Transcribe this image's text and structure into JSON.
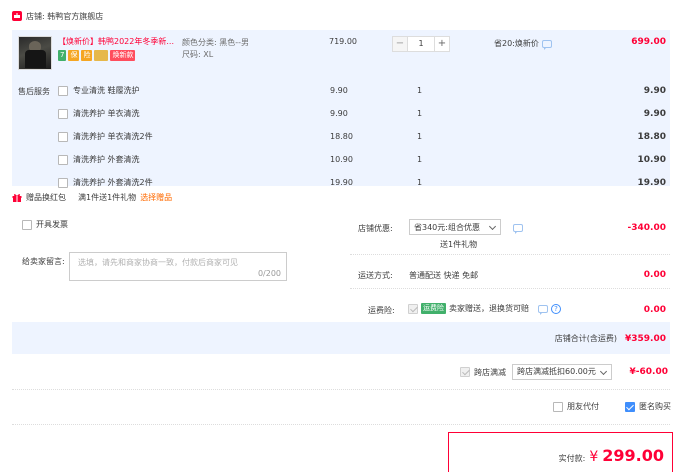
{
  "shop": {
    "label": "店铺: 韩鸭官方旗舰店"
  },
  "item": {
    "promo_tag": "【焕新价】",
    "title": "韩鸭2022年冬季新...",
    "spec1": "颜色分类: 黑色--男",
    "spec2": "尺码: XL",
    "unit_price": "719.00",
    "quantity": "1",
    "save_text": "省20:焕新价",
    "total": "699.00",
    "badges": [
      "7",
      "保",
      "险",
      "焕新款"
    ]
  },
  "after_sales": {
    "label": "售后服务",
    "options": [
      {
        "name": "专业清洗 鞋履洗护",
        "price": "9.90",
        "qty": "1",
        "total": "9.90"
      },
      {
        "name": "清洗养护 单衣清洗",
        "price": "9.90",
        "qty": "1",
        "total": "9.90"
      },
      {
        "name": "清洗养护 单衣清洗2件",
        "price": "18.80",
        "qty": "1",
        "total": "18.80"
      },
      {
        "name": "清洗养护 外套清洗",
        "price": "10.90",
        "qty": "1",
        "total": "10.90"
      },
      {
        "name": "清洗养护 外套清洗2件",
        "price": "19.90",
        "qty": "1",
        "total": "19.90"
      }
    ]
  },
  "gift": {
    "label": "赠品换红包",
    "text": "满1件送1件礼物",
    "link": "选择赠品"
  },
  "invoice": {
    "label": "开具发票"
  },
  "message": {
    "label": "给卖家留言:",
    "placeholder": "选填，请先和商家协商一致，付款后商家可见",
    "counter": "0/200"
  },
  "shop_discount": {
    "label": "店铺优惠:",
    "select": "省340元:组合优惠",
    "note": "送1件礼物",
    "amount": "-340.00"
  },
  "shipping": {
    "label": "运送方式:",
    "method": "普通配送 快递 免邮",
    "amount": "0.00"
  },
  "insurance": {
    "label": "运费险:",
    "badge": "运费险",
    "text": "卖家赠送，退换货可赔",
    "amount": "0.00"
  },
  "shop_total": {
    "label": "店铺合计(含运费)",
    "amount": "¥359.00"
  },
  "cross_discount": {
    "label": "跨店满减",
    "select": "跨店满减抵扣60.00元",
    "amount": "¥-60.00"
  },
  "options_row": {
    "friend_pay": "朋友代付",
    "anonymous": "匿名购买"
  },
  "payment": {
    "label": "实付款:",
    "currency": "¥",
    "amount": "299.00"
  },
  "colors": {
    "accent": "#ff0036",
    "blue": "#3f8efc",
    "panel": "#eef4ff"
  }
}
